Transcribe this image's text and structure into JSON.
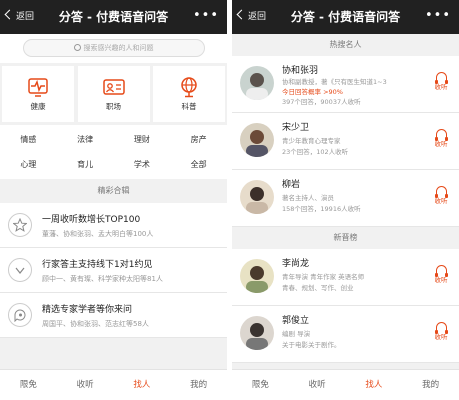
{
  "colors": {
    "accent": "#e64a19",
    "navbar": "#212121"
  },
  "left": {
    "nav": {
      "back": "返回",
      "title": "分答 - 付费语音问答",
      "more": "•••"
    },
    "search": {
      "placeholder": "搜索感兴趣的人和问题"
    },
    "categories": [
      {
        "label": "健康",
        "icon": "heartbeat-icon"
      },
      {
        "label": "职场",
        "icon": "id-card-icon"
      },
      {
        "label": "科普",
        "icon": "globe-icon"
      }
    ],
    "tags": [
      "情感",
      "法律",
      "理财",
      "房产",
      "心理",
      "育儿",
      "学术",
      "全部"
    ],
    "section_title": "精彩合辑",
    "collections": [
      {
        "title": "一周收听数增长TOP100",
        "subtitle": "董藩、协和张羽、孟大明白等100人",
        "icon": "star-icon"
      },
      {
        "title": "行家答主支持线下1对1约见",
        "subtitle": "顾中一、黄有璨、科学家种太阳等81人",
        "icon": "chevron-down-icon"
      },
      {
        "title": "精选专家学者等你来问",
        "subtitle": "周国平、协和张羽、范志红等58人",
        "icon": "question-icon"
      }
    ],
    "tabs": [
      "限免",
      "收听",
      "找人",
      "我的"
    ],
    "active_tab": "找人"
  },
  "right": {
    "nav": {
      "back": "返回",
      "title": "分答 - 付费语音问答",
      "more": "•••"
    },
    "section1": "热搜名人",
    "people1": [
      {
        "name": "协和张羽",
        "lines": [
          "协和副教授，著《只有医生知道1~3",
          "今日回答概率 >90%",
          "397个回答，90037人收听"
        ],
        "listen": "收听"
      },
      {
        "name": "宋少卫",
        "lines": [
          "青少年教育心理专家",
          "23个回答，102人收听"
        ],
        "listen": "收听"
      },
      {
        "name": "柳岩",
        "lines": [
          "著名主持人、演员",
          "158个回答，19916人收听"
        ],
        "listen": "收听"
      }
    ],
    "section2": "新晋榜",
    "people2": [
      {
        "name": "李尚龙",
        "lines": [
          "青年导演 青年作家 英语名师",
          "青春、规划、写作、创业"
        ],
        "listen": "收听"
      },
      {
        "name": "郭俊立",
        "lines": [
          "编剧 导演",
          "关于电影关于剧作。"
        ],
        "listen": "收听"
      }
    ],
    "tabs": [
      "限免",
      "收听",
      "找人",
      "我的"
    ],
    "active_tab": "找人"
  }
}
